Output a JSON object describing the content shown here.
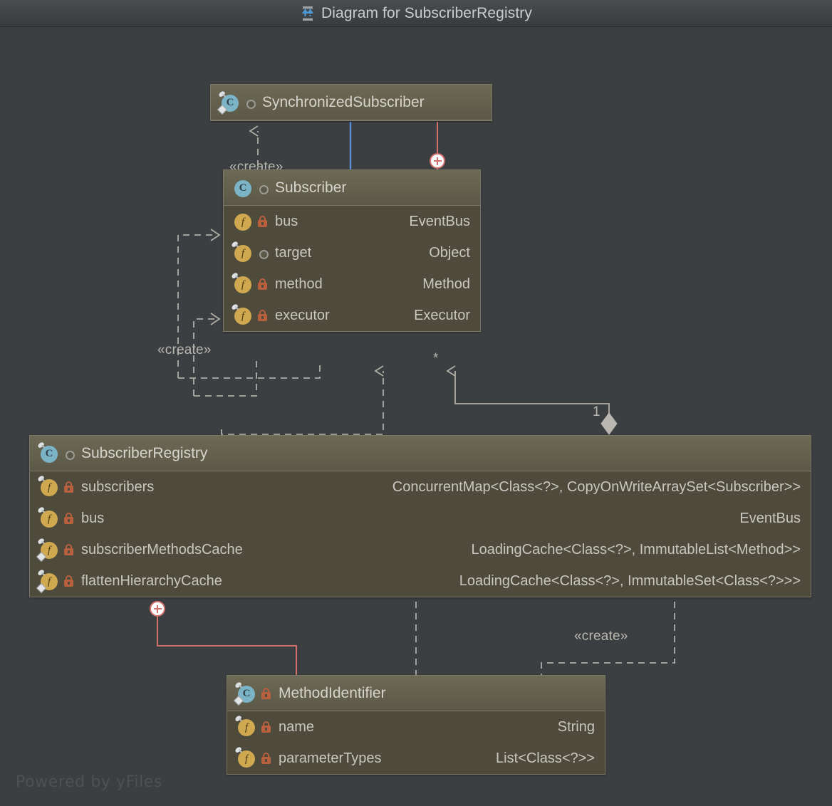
{
  "window": {
    "title": "Diagram for SubscriberRegistry",
    "icon": "diagram-hierarchy-icon"
  },
  "watermark": "Powered by yFiles",
  "colors": {
    "canvas_bg": "#3c3f41",
    "node_body": "#4e4b3d",
    "node_header": "#63604e",
    "node_border": "#7b7868",
    "text": "#c9c7bf",
    "class_icon": "#7ab4c6",
    "field_icon": "#cfa84f",
    "private_lock": "#b9603e",
    "inheritance_arrow": "#5b8fd4",
    "inner_class_edge": "#d4706b",
    "dependency_edge": "#b0aea6",
    "aggregation_edge": "#b0aea6"
  },
  "nodes": [
    {
      "id": "SynchronizedSubscriber",
      "name": "SynchronizedSubscriber",
      "icon": "class-icon",
      "visibility": "package-private",
      "final": true,
      "static": true,
      "fields": []
    },
    {
      "id": "Subscriber",
      "name": "Subscriber",
      "icon": "class-icon",
      "visibility": "package-private",
      "final": false,
      "static": false,
      "fields": [
        {
          "name": "bus",
          "type": "EventBus",
          "visibility": "private",
          "final": false,
          "static": false
        },
        {
          "name": "target",
          "type": "Object",
          "visibility": "package-private",
          "final": true,
          "static": false
        },
        {
          "name": "method",
          "type": "Method",
          "visibility": "private",
          "final": true,
          "static": false
        },
        {
          "name": "executor",
          "type": "Executor",
          "visibility": "private",
          "final": true,
          "static": false
        }
      ]
    },
    {
      "id": "SubscriberRegistry",
      "name": "SubscriberRegistry",
      "icon": "class-icon",
      "visibility": "package-private",
      "final": true,
      "static": false,
      "fields": [
        {
          "name": "subscribers",
          "type": "ConcurrentMap<Class<?>, CopyOnWriteArraySet<Subscriber>>",
          "visibility": "private",
          "final": true,
          "static": false
        },
        {
          "name": "bus",
          "type": "EventBus",
          "visibility": "private",
          "final": true,
          "static": false
        },
        {
          "name": "subscriberMethodsCache",
          "type": "LoadingCache<Class<?>, ImmutableList<Method>>",
          "visibility": "private",
          "final": true,
          "static": true
        },
        {
          "name": "flattenHierarchyCache",
          "type": "LoadingCache<Class<?>, ImmutableSet<Class<?>>>",
          "visibility": "private",
          "final": true,
          "static": true
        }
      ]
    },
    {
      "id": "MethodIdentifier",
      "name": "MethodIdentifier",
      "icon": "class-icon",
      "visibility": "private",
      "final": true,
      "static": true,
      "fields": [
        {
          "name": "name",
          "type": "String",
          "visibility": "private",
          "final": true,
          "static": false
        },
        {
          "name": "parameterTypes",
          "type": "List<Class<?>>",
          "visibility": "private",
          "final": true,
          "static": false
        }
      ]
    }
  ],
  "edges": [
    {
      "id": "e1",
      "type": "dependency",
      "stereotype": "«create»",
      "from": "Subscriber",
      "to": "SynchronizedSubscriber",
      "style": "dashed",
      "color": "#b0aea6"
    },
    {
      "id": "e2",
      "type": "inheritance",
      "stereotype": "",
      "from": "SynchronizedSubscriber",
      "to": "Subscriber",
      "style": "solid",
      "color": "#5b8fd4"
    },
    {
      "id": "e3",
      "type": "inner-class",
      "stereotype": "",
      "from": "SynchronizedSubscriber",
      "to": "Subscriber",
      "style": "solid",
      "color": "#d4706b"
    },
    {
      "id": "e4",
      "type": "dependency",
      "stereotype": "«create»",
      "from": "Subscriber",
      "to": "Subscriber",
      "style": "dashed",
      "color": "#b0aea6"
    },
    {
      "id": "e5",
      "type": "dependency",
      "stereotype": "",
      "from": "SubscriberRegistry",
      "to": "Subscriber",
      "style": "dashed",
      "color": "#b0aea6"
    },
    {
      "id": "e6",
      "type": "aggregation",
      "stereotype": "",
      "from": "SubscriberRegistry",
      "to": "Subscriber",
      "style": "solid",
      "color": "#b0aea6",
      "source_multiplicity": "1",
      "target_multiplicity": "*"
    },
    {
      "id": "e7",
      "type": "inner-class",
      "stereotype": "",
      "from": "SubscriberRegistry",
      "to": "MethodIdentifier",
      "style": "solid",
      "color": "#d4706b"
    },
    {
      "id": "e8",
      "type": "dependency",
      "stereotype": "",
      "from": "SubscriberRegistry",
      "to": "MethodIdentifier",
      "style": "dashed",
      "color": "#b0aea6"
    },
    {
      "id": "e9",
      "type": "dependency",
      "stereotype": "«create»",
      "from": "SubscriberRegistry",
      "to": "MethodIdentifier",
      "style": "dashed",
      "color": "#b0aea6"
    }
  ],
  "edge_labels": {
    "create_top": "«create»",
    "create_left": "«create»",
    "create_bottom": "«create»",
    "mult_star": "*",
    "mult_one": "1"
  }
}
